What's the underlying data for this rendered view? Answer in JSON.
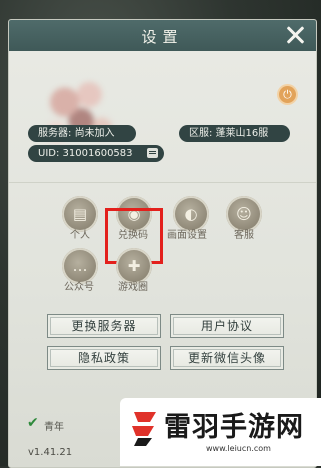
{
  "window": {
    "title": "设置"
  },
  "profile": {
    "server_label": "服务器:",
    "server_value": "尚未加入",
    "zone_label": "区服:",
    "zone_value": "蓬莱山16服",
    "uid_label": "UID:",
    "uid_value": "31001600583"
  },
  "icons": [
    {
      "label": "个人",
      "glyph": "▤"
    },
    {
      "label": "兑换码",
      "glyph": "◉"
    },
    {
      "label": "画面设置",
      "glyph": "◐"
    },
    {
      "label": "客服",
      "glyph": "☺"
    },
    {
      "label": "公众号",
      "glyph": "…"
    },
    {
      "label": "游戏圈",
      "glyph": "✚"
    }
  ],
  "buttons": {
    "change_server": "更换服务器",
    "user_agreement": "用户协议",
    "privacy_policy": "隐私政策",
    "update_wechat_avatar": "更新微信头像"
  },
  "footer": {
    "check_text": "青年",
    "version": "v1.41.21"
  },
  "watermark": {
    "brand": "雷羽手游网",
    "url": "www.leiucn.com"
  },
  "colors": {
    "header": "#4f6b6a",
    "pill_bg": "#314443",
    "highlight": "#e3201c",
    "panel": "#e9eae4"
  }
}
